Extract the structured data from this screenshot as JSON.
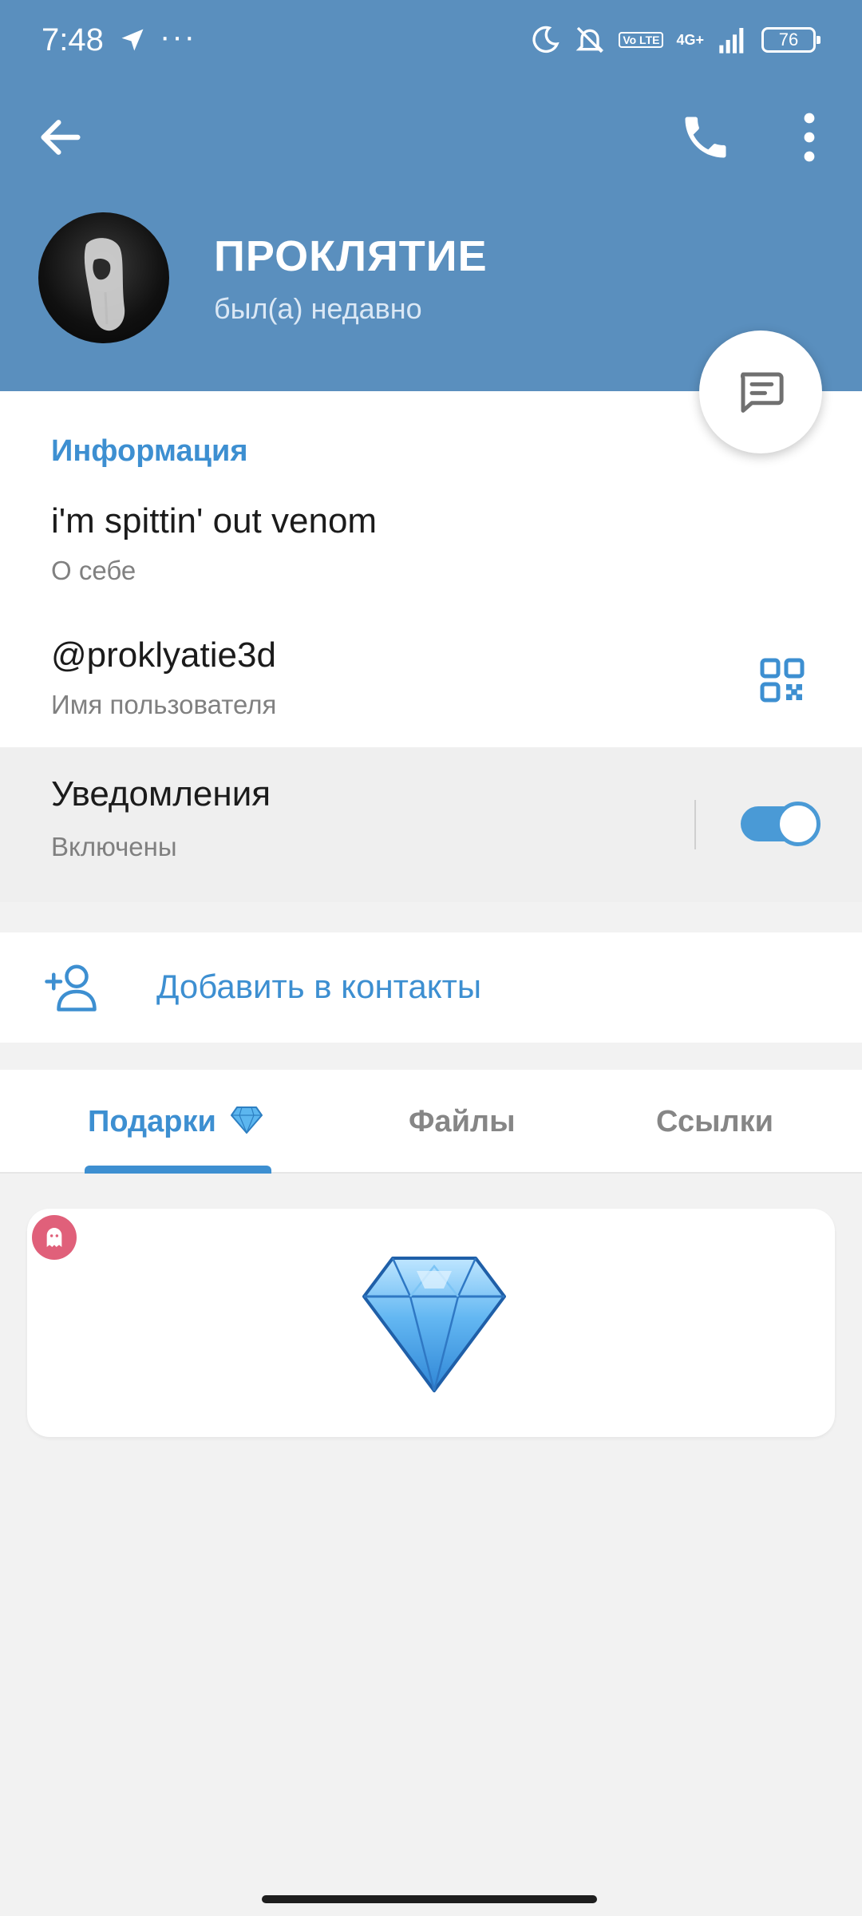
{
  "status_bar": {
    "time": "7:48",
    "dots": "···",
    "volte": "Vo LTE",
    "network": "4G+",
    "battery": "76"
  },
  "header": {
    "name": "ПРОКЛЯТИЕ",
    "status": "был(а) недавно",
    "background_color": "#5a8fbe"
  },
  "info": {
    "section_title": "Информация",
    "bio": "i'm spittin' out venom",
    "bio_label": "О себе",
    "username": "@proklyatie3d",
    "username_label": "Имя пользователя",
    "notifications_title": "Уведомления",
    "notifications_state": "Включены",
    "notifications_enabled": true
  },
  "actions": {
    "add_contact": "Добавить в контакты"
  },
  "tabs": {
    "items": [
      {
        "label": "Подарки",
        "active": true
      },
      {
        "label": "Файлы",
        "active": false
      },
      {
        "label": "Ссылки",
        "active": false
      }
    ]
  },
  "icons": {
    "back": "arrow-left-icon",
    "call": "phone-icon",
    "more": "more-vertical-icon",
    "message": "message-icon",
    "qr": "qr-code-icon",
    "add_contact": "add-user-icon",
    "gift": "diamond-icon",
    "badge": "ghost-icon"
  },
  "accent_color": "#3d8fd1"
}
